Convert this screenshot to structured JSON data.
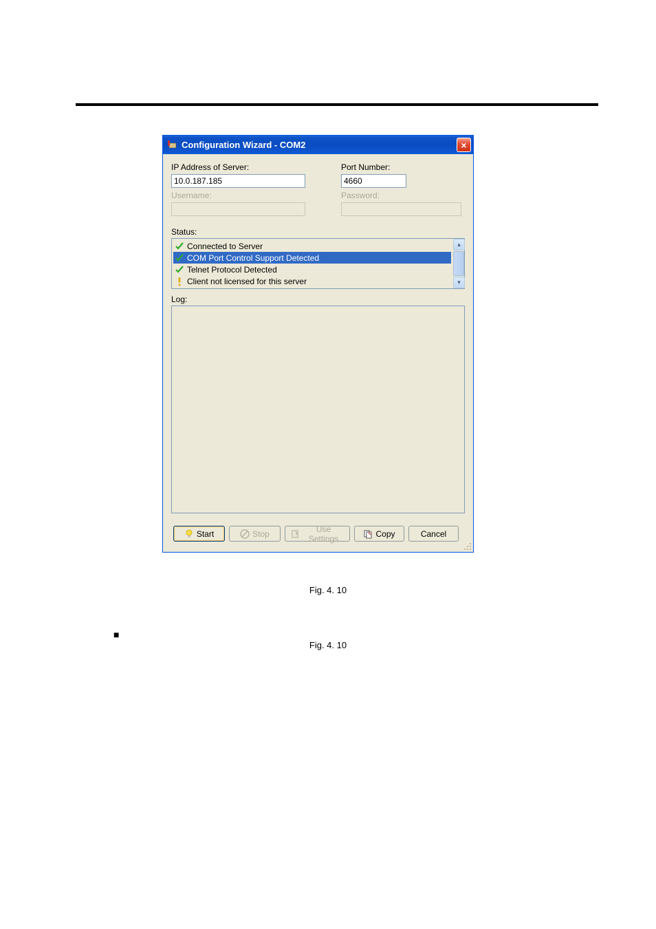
{
  "dialog": {
    "title": "Configuration Wizard - COM2",
    "ip_label": "IP Address of Server:",
    "ip_value": "10.0.187.185",
    "port_label": "Port Number:",
    "port_value": "4660",
    "username_label": "Username:",
    "username_value": "",
    "password_label": "Password:",
    "password_value": "",
    "status_label": "Status:",
    "status_items": [
      {
        "text": "Connected to Server",
        "type": "check"
      },
      {
        "text": "COM Port Control Support Detected",
        "type": "check",
        "selected": true
      },
      {
        "text": "Telnet Protocol Detected",
        "type": "check"
      },
      {
        "text": "Client not licensed for this server",
        "type": "warn"
      }
    ],
    "log_label": "Log:",
    "buttons": {
      "start": "Start",
      "stop": "Stop",
      "use_settings": "Use Settings",
      "copy": "Copy",
      "cancel": "Cancel"
    }
  },
  "captions": {
    "fig1": "Fig. 4. 10",
    "fig2": "Fig. 4. 10"
  },
  "icons": {
    "close": "×",
    "up": "▴",
    "down": "▾",
    "bullet": "■"
  }
}
